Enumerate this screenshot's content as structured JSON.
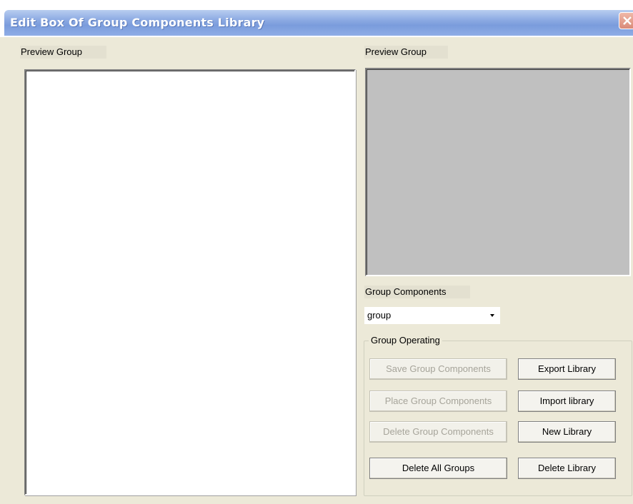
{
  "window": {
    "title": "Edit Box Of Group Components Library",
    "close_icon": "close-icon"
  },
  "left": {
    "label": "Preview Group"
  },
  "right": {
    "preview_label": "Preview Group",
    "components_label": "Group Components",
    "combo_value": "group",
    "group_operating_label": "Group Operating"
  },
  "buttons": {
    "save_group": "Save Group Components",
    "place_group": "Place Group Components",
    "delete_group": "Delete Group Components",
    "delete_all_groups": "Delete All Groups",
    "export_library": "Export Library",
    "import_library": "Import library",
    "new_library": "New Library",
    "delete_library": "Delete Library"
  },
  "colors": {
    "dialog_bg": "#ece9d8",
    "preview_bg": "#c0c0c0",
    "titlebar": "#7a9cdc",
    "close_button": "#d98a78"
  }
}
